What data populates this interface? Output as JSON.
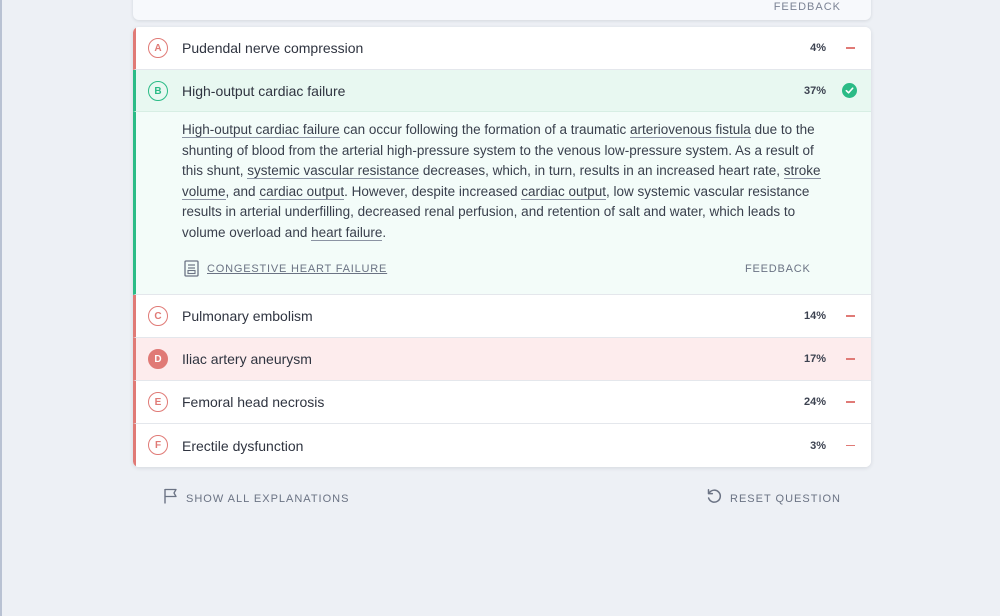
{
  "top_card": {
    "feedback_label": "FEEDBACK"
  },
  "answers": [
    {
      "letter": "A",
      "text": "Pudendal nerve compression",
      "percent": "4%",
      "state": "incorrect"
    },
    {
      "letter": "B",
      "text": "High-output cardiac failure",
      "percent": "37%",
      "state": "correct"
    },
    {
      "letter": "C",
      "text": "Pulmonary embolism",
      "percent": "14%",
      "state": "incorrect"
    },
    {
      "letter": "D",
      "text": "Iliac artery aneurysm",
      "percent": "17%",
      "state": "selected"
    },
    {
      "letter": "E",
      "text": "Femoral head necrosis",
      "percent": "24%",
      "state": "incorrect"
    },
    {
      "letter": "F",
      "text": "Erectile dysfunction",
      "percent": "3%",
      "state": "incorrect"
    }
  ],
  "explanation": {
    "segments": [
      {
        "text": "High-output cardiac failure",
        "link": true
      },
      {
        "text": " can occur following the formation of a traumatic ",
        "link": false
      },
      {
        "text": "arteriovenous fistula",
        "link": true
      },
      {
        "text": " due to the shunting of blood from the arterial high-pressure system to the venous low-pressure system. As a result of this shunt, ",
        "link": false
      },
      {
        "text": "systemic vascular resistance",
        "link": true
      },
      {
        "text": " decreases, which, in turn, results in an increased heart rate, ",
        "link": false
      },
      {
        "text": "stroke volume",
        "link": true
      },
      {
        "text": ", and ",
        "link": false
      },
      {
        "text": "cardiac output",
        "link": true
      },
      {
        "text": ". However, despite increased ",
        "link": false
      },
      {
        "text": "cardiac output",
        "link": true
      },
      {
        "text": ", low systemic vascular resistance results in arterial underfilling, decreased renal perfusion, and retention of salt and water, which leads to volume overload and ",
        "link": false
      },
      {
        "text": "heart failure",
        "link": true
      },
      {
        "text": ".",
        "link": false
      }
    ],
    "article_link": "CONGESTIVE HEART FAILURE",
    "feedback_label": "FEEDBACK"
  },
  "actions": {
    "show_all": "SHOW ALL EXPLANATIONS",
    "reset": "RESET QUESTION"
  },
  "colors": {
    "correct": "#2bbb86",
    "incorrect": "#e07a76",
    "selected_bg": "#fdeced",
    "correct_bg": "#e8f8f1"
  }
}
